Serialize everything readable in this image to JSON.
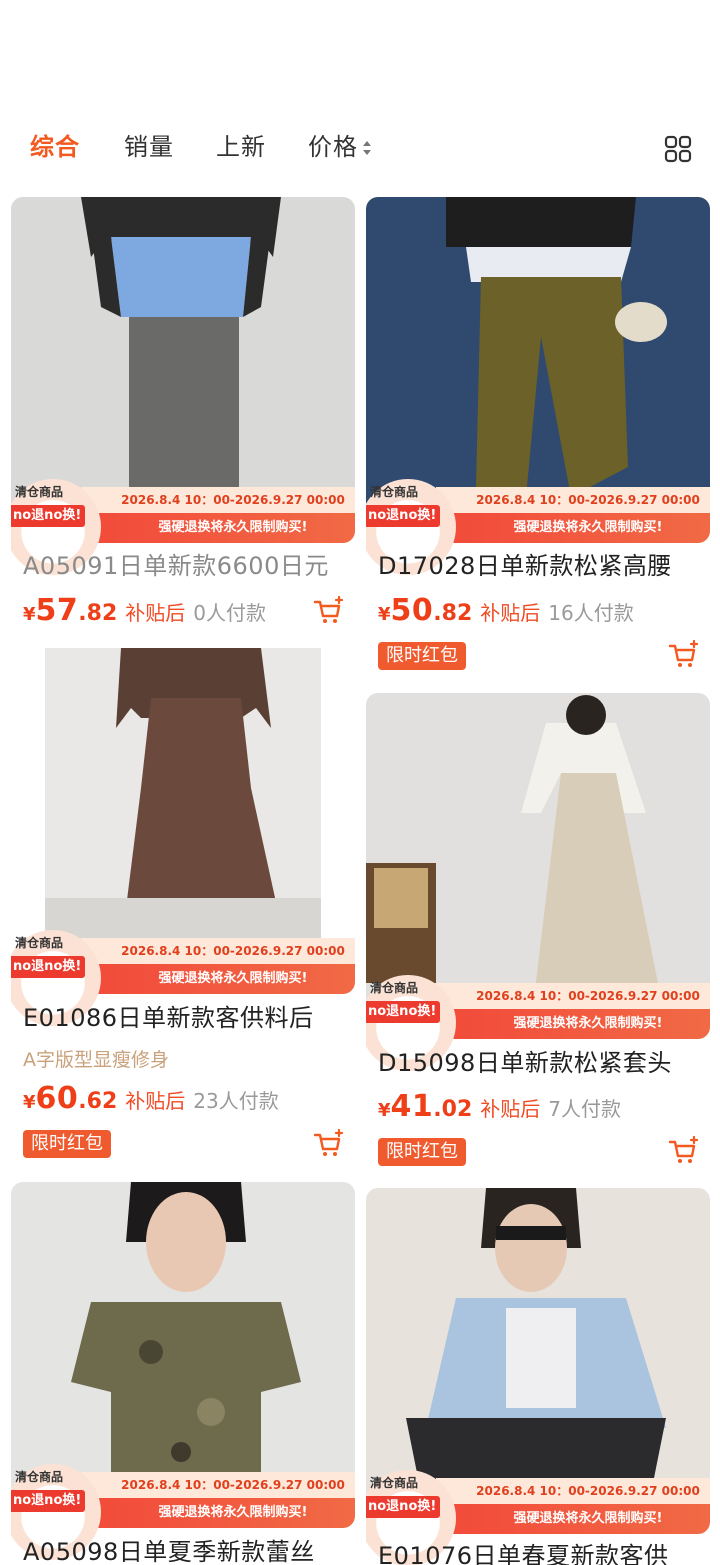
{
  "tabs": [
    {
      "label": "综合",
      "active": true
    },
    {
      "label": "销量",
      "active": false
    },
    {
      "label": "上新",
      "active": false
    },
    {
      "label": "价格",
      "active": false
    }
  ],
  "colors": {
    "accent": "#f35a1f",
    "price": "#ee3f19",
    "promo_red": "#ec3a2e",
    "tag_bg": "#ef5a2e"
  },
  "promo": {
    "badge_top": "清仓商品",
    "badge_bottom": "no退no换!",
    "date_range": "2026.8.4 10：00-2026.9.27 00:00",
    "warning": "强硬退换将永久限制购买!"
  },
  "products": [
    {
      "title": "A05091日单新款6600日元",
      "subtitle": "",
      "yen": "¥",
      "price_int": "57",
      "price_dec": ".82",
      "after": "补贴后",
      "paid": "0人付款",
      "tag": ""
    },
    {
      "title": "D17028日单新款松紧高腰",
      "subtitle": "",
      "yen": "¥",
      "price_int": "50",
      "price_dec": ".82",
      "after": "补贴后",
      "paid": "16人付款",
      "tag": "限时红包"
    },
    {
      "title": "E01086日单新款客供料后",
      "subtitle": "A字版型显瘦修身",
      "yen": "¥",
      "price_int": "60",
      "price_dec": ".62",
      "after": "补贴后",
      "paid": "23人付款",
      "tag": "限时红包"
    },
    {
      "title": "D15098日单新款松紧套头",
      "subtitle": "",
      "yen": "¥",
      "price_int": "41",
      "price_dec": ".02",
      "after": "补贴后",
      "paid": "7人付款",
      "tag": "限时红包"
    },
    {
      "title": "A05098日单夏季新款蕾丝",
      "subtitle": "",
      "yen": "",
      "price_int": "",
      "price_dec": "",
      "after": "",
      "paid": "",
      "tag": ""
    },
    {
      "title": "E01076日单春夏新款客供",
      "subtitle": "",
      "yen": "",
      "price_int": "",
      "price_dec": "",
      "after": "",
      "paid": "",
      "tag": ""
    }
  ]
}
